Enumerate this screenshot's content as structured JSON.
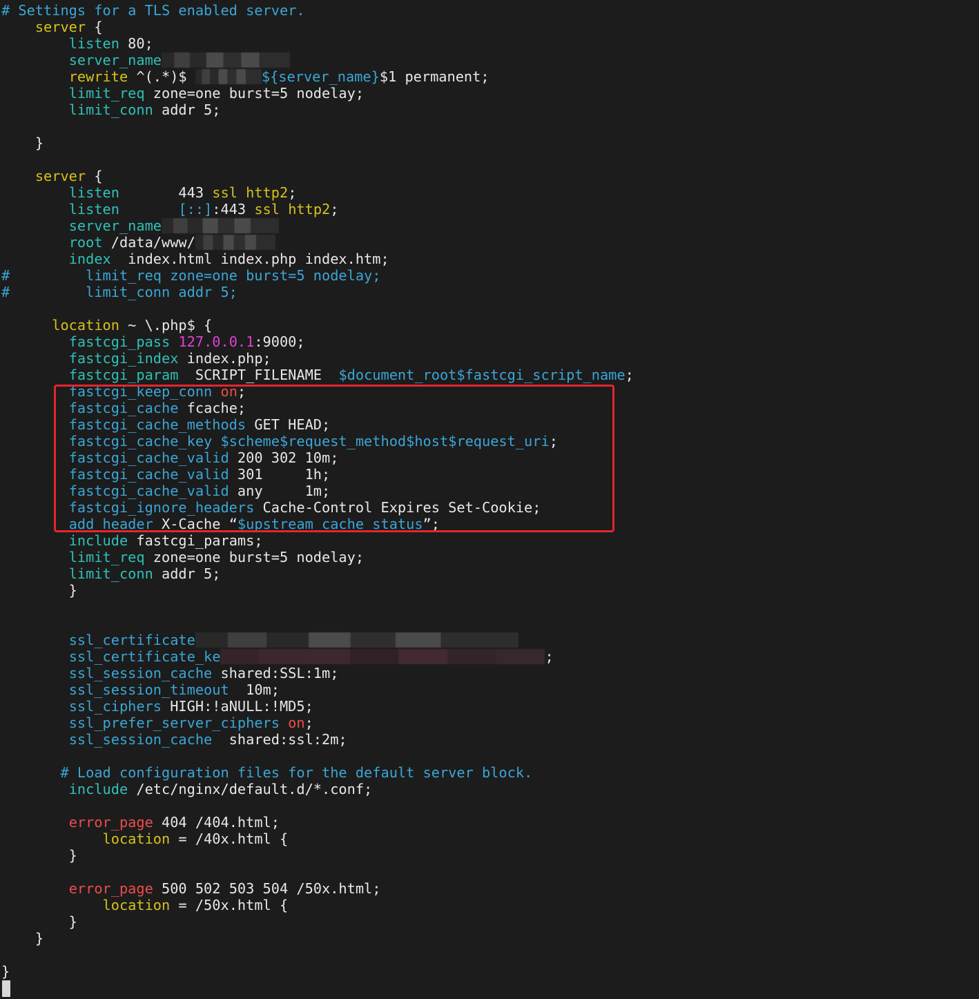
{
  "palette": {
    "background": "#1c1c1c",
    "text": "#e8e8e8",
    "comment": "#3aa6d6",
    "keyword": "#d6c21b",
    "directive": "#2fc0b8",
    "red": "#ef4b4b",
    "pink": "#e23fd3",
    "highlight_box": "#e3262e"
  },
  "lines": [
    [
      {
        "t": "# Settings for a TLS enabled server.",
        "c": "comment"
      }
    ],
    [
      {
        "t": "    "
      },
      {
        "t": "server",
        "c": "kw"
      },
      {
        "t": " {"
      }
    ],
    [
      {
        "t": "        "
      },
      {
        "t": "listen",
        "c": "dir"
      },
      {
        "t": " 80;"
      }
    ],
    [
      {
        "t": "        "
      },
      {
        "t": "server_name",
        "c": "dir"
      },
      {
        "r": 186
      }
    ],
    [
      {
        "t": "        "
      },
      {
        "t": "rewrite",
        "c": "kw"
      },
      {
        "t": " ^(.*)$ "
      },
      {
        "r": 96
      },
      {
        "t": "${server_name}",
        "c": "blue"
      },
      {
        "t": "$1 permanent;"
      }
    ],
    [
      {
        "t": "        "
      },
      {
        "t": "limit_req",
        "c": "dir"
      },
      {
        "t": " zone=one burst=5 nodelay;"
      }
    ],
    [
      {
        "t": "        "
      },
      {
        "t": "limit_conn",
        "c": "dir"
      },
      {
        "t": " addr 5;"
      }
    ],
    [],
    [
      {
        "t": "    }"
      }
    ],
    [],
    [
      {
        "t": "    "
      },
      {
        "t": "server",
        "c": "kw"
      },
      {
        "t": " {"
      }
    ],
    [
      {
        "t": "        "
      },
      {
        "t": "listen",
        "c": "dir"
      },
      {
        "t": "       443 "
      },
      {
        "t": "ssl",
        "c": "kw"
      },
      {
        "t": " "
      },
      {
        "t": "http2",
        "c": "kw"
      },
      {
        "t": ";"
      }
    ],
    [
      {
        "t": "        "
      },
      {
        "t": "listen",
        "c": "dir"
      },
      {
        "t": "       "
      },
      {
        "t": "[::]",
        "c": "blue"
      },
      {
        "t": ":443 "
      },
      {
        "t": "ssl",
        "c": "kw"
      },
      {
        "t": " "
      },
      {
        "t": "http2",
        "c": "kw"
      },
      {
        "t": ";"
      }
    ],
    [
      {
        "t": "        "
      },
      {
        "t": "server_name",
        "c": "dir"
      },
      {
        "r": 170
      }
    ],
    [
      {
        "t": "        "
      },
      {
        "t": "root",
        "c": "dir"
      },
      {
        "t": " /data/www/"
      },
      {
        "r": 116
      }
    ],
    [
      {
        "t": "        "
      },
      {
        "t": "index",
        "c": "dir"
      },
      {
        "t": "  index.html index.php index.htm;"
      }
    ],
    [
      {
        "t": "#         limit_req zone=one burst=5 nodelay;",
        "c": "comment"
      }
    ],
    [
      {
        "t": "#         limit_conn addr 5;",
        "c": "comment"
      }
    ],
    [],
    [
      {
        "t": "      "
      },
      {
        "t": "location",
        "c": "kw"
      },
      {
        "t": " ~ \\.php$ {"
      }
    ],
    [
      {
        "t": "        "
      },
      {
        "t": "fastcgi_pass",
        "c": "dir"
      },
      {
        "t": " "
      },
      {
        "t": "127.0.0.1",
        "c": "pink"
      },
      {
        "t": ":9000;"
      }
    ],
    [
      {
        "t": "        "
      },
      {
        "t": "fastcgi_index",
        "c": "dir"
      },
      {
        "t": " index.php;"
      }
    ],
    [
      {
        "t": "        "
      },
      {
        "t": "fastcgi_param",
        "c": "dir"
      },
      {
        "t": "  SCRIPT_FILENAME  "
      },
      {
        "t": "$document_root$fastcgi_script_name",
        "c": "blue"
      },
      {
        "t": ";"
      }
    ],
    [
      {
        "t": "        "
      },
      {
        "t": "fastcgi_keep_conn",
        "c": "blue"
      },
      {
        "t": " "
      },
      {
        "t": "on",
        "c": "red"
      },
      {
        "t": ";"
      }
    ],
    [
      {
        "t": "        "
      },
      {
        "t": "fastcgi_cache",
        "c": "blue"
      },
      {
        "t": " fcache;"
      }
    ],
    [
      {
        "t": "        "
      },
      {
        "t": "fastcgi_cache_methods",
        "c": "blue"
      },
      {
        "t": " GET HEAD;"
      }
    ],
    [
      {
        "t": "        "
      },
      {
        "t": "fastcgi_cache_key",
        "c": "blue"
      },
      {
        "t": " "
      },
      {
        "t": "$scheme$request_method$host$request_uri",
        "c": "blue"
      },
      {
        "t": ";"
      }
    ],
    [
      {
        "t": "        "
      },
      {
        "t": "fastcgi_cache_valid",
        "c": "blue"
      },
      {
        "t": " 200 302 10m;"
      }
    ],
    [
      {
        "t": "        "
      },
      {
        "t": "fastcgi_cache_valid",
        "c": "blue"
      },
      {
        "t": " 301     1h;"
      }
    ],
    [
      {
        "t": "        "
      },
      {
        "t": "fastcgi_cache_valid",
        "c": "blue"
      },
      {
        "t": " any     1m;"
      }
    ],
    [
      {
        "t": "        "
      },
      {
        "t": "fastcgi_ignore_headers",
        "c": "blue"
      },
      {
        "t": " Cache-Control Expires Set-Cookie;"
      }
    ],
    [
      {
        "t": "        "
      },
      {
        "t": "add_header",
        "c": "blue"
      },
      {
        "t": " X-Cache “"
      },
      {
        "t": "$upstream_cache_status",
        "c": "blue"
      },
      {
        "t": "”;"
      }
    ],
    [
      {
        "t": "        "
      },
      {
        "t": "include",
        "c": "dir"
      },
      {
        "t": " fastcgi_params;"
      }
    ],
    [
      {
        "t": "        "
      },
      {
        "t": "limit_req",
        "c": "dir"
      },
      {
        "t": " zone=one burst=5 nodelay;"
      }
    ],
    [
      {
        "t": "        "
      },
      {
        "t": "limit_conn",
        "c": "dir"
      },
      {
        "t": " addr 5;"
      }
    ],
    [
      {
        "t": "        }"
      }
    ],
    [],
    [],
    [
      {
        "t": "        "
      },
      {
        "t": "ssl_certificate",
        "c": "blue"
      },
      {
        "r": 468
      }
    ],
    [
      {
        "t": "        "
      },
      {
        "t": "ssl_certificate_ke",
        "c": "blue"
      },
      {
        "r": 470,
        "p": true
      },
      {
        "t": ";"
      }
    ],
    [
      {
        "t": "        "
      },
      {
        "t": "ssl_session_cache",
        "c": "blue"
      },
      {
        "t": " shared:SSL:1m;"
      }
    ],
    [
      {
        "t": "        "
      },
      {
        "t": "ssl_session_timeout",
        "c": "blue"
      },
      {
        "t": "  10m;"
      }
    ],
    [
      {
        "t": "        "
      },
      {
        "t": "ssl_ciphers",
        "c": "blue"
      },
      {
        "t": " HIGH:!aNULL:!MD5;"
      }
    ],
    [
      {
        "t": "        "
      },
      {
        "t": "ssl_prefer_server_ciphers",
        "c": "blue"
      },
      {
        "t": " "
      },
      {
        "t": "on",
        "c": "red"
      },
      {
        "t": ";"
      }
    ],
    [
      {
        "t": "        "
      },
      {
        "t": "ssl_session_cache",
        "c": "blue"
      },
      {
        "t": "  shared:ssl:2m;"
      }
    ],
    [],
    [
      {
        "t": "       "
      },
      {
        "t": "# Load configuration files for the default server block.",
        "c": "comment"
      }
    ],
    [
      {
        "t": "        "
      },
      {
        "t": "include",
        "c": "dir"
      },
      {
        "t": " /etc/nginx/default.d/*.conf;"
      }
    ],
    [],
    [
      {
        "t": "        "
      },
      {
        "t": "error_page",
        "c": "red"
      },
      {
        "t": " 404 /404.html;"
      }
    ],
    [
      {
        "t": "            "
      },
      {
        "t": "location",
        "c": "kw"
      },
      {
        "t": " = /40x.html {"
      }
    ],
    [
      {
        "t": "        }"
      }
    ],
    [],
    [
      {
        "t": "        "
      },
      {
        "t": "error_page",
        "c": "red"
      },
      {
        "t": " 500 502 503 504 /50x.html;"
      }
    ],
    [
      {
        "t": "            "
      },
      {
        "t": "location",
        "c": "kw"
      },
      {
        "t": " = /50x.html {"
      }
    ],
    [
      {
        "t": "        }"
      }
    ],
    [
      {
        "t": "    }"
      }
    ],
    [],
    [
      {
        "t": "}"
      }
    ]
  ]
}
